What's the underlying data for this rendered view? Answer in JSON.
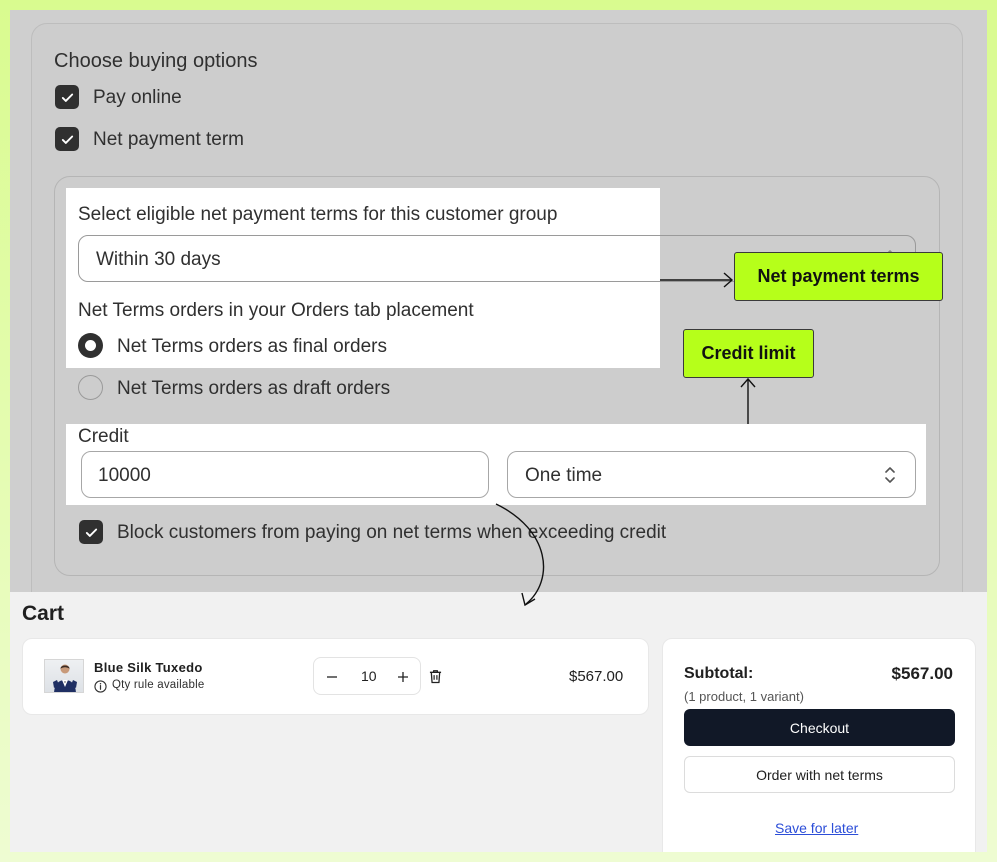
{
  "settings": {
    "section_title": "Choose buying options",
    "option_pay_online": "Pay online",
    "option_net_payment": "Net payment term",
    "net_terms_label": "Select eligible net payment terms for this customer group",
    "net_terms_value": "Within 30 days",
    "placement_label": "Net Terms orders in your Orders tab placement",
    "radio_final": "Net Terms orders as final orders",
    "radio_draft": "Net Terms orders as draft orders",
    "credit_label": "Credit",
    "credit_value": "10000",
    "credit_frequency": "One time",
    "block_label": "Block customers from paying on net terms when exceeding credit"
  },
  "callouts": {
    "net_payment_terms": "Net payment terms",
    "credit_limit": "Credit limit"
  },
  "cart": {
    "title": "Cart",
    "item": {
      "name": "Blue Silk Tuxedo",
      "rule": "Qty rule available",
      "quantity": "10",
      "price": "$567.00"
    },
    "summary": {
      "subtotal_label": "Subtotal:",
      "subtotal_value": "$567.00",
      "count_text": "(1 product, 1 variant)",
      "checkout_label": "Checkout",
      "net_terms_label": "Order with net terms",
      "save_label": "Save for later"
    }
  },
  "colors": {
    "accent_callout": "#b6ff1a",
    "checkout_button": "#111827",
    "link": "#2c4ed8"
  }
}
